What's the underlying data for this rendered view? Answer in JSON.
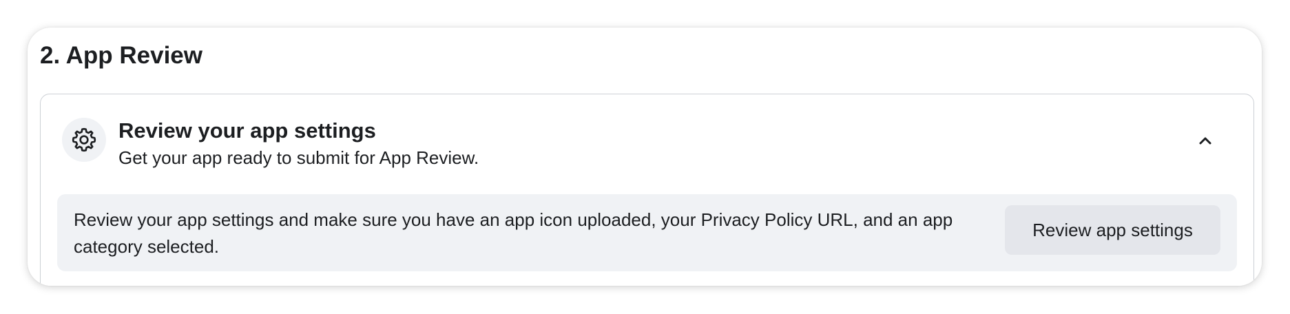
{
  "section": {
    "title": "2. App Review"
  },
  "review_item": {
    "icon": "gear-icon",
    "title": "Review your app settings",
    "subtitle": "Get your app ready to submit for App Review.",
    "toggle_icon": "chevron-up-icon",
    "expanded": true,
    "detail_text": "Review your app settings and make sure you have an app icon uploaded, your Privacy Policy URL, and an app category selected.",
    "button_label": "Review app settings"
  },
  "colors": {
    "text": "#1c1e21",
    "panel_background": "#f0f2f5",
    "button_background": "#e4e6eb",
    "border": "#ccd0d5"
  }
}
